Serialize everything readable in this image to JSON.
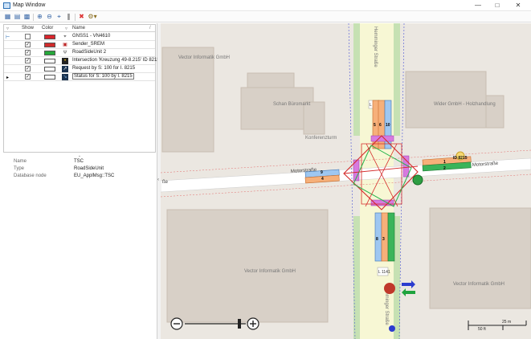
{
  "window": {
    "title": "Map Window"
  },
  "toolbar": {
    "icons": [
      "layers-icon",
      "open-icon",
      "save-icon",
      "zoom-in-icon",
      "zoom-out-icon",
      "zoom-fit-icon",
      "pause-icon",
      "close-icon",
      "settings-icon"
    ]
  },
  "layers": {
    "headers": {
      "show": "Show",
      "color": "Color",
      "name": "Name"
    },
    "rows": [
      {
        "name": "GNSS1 - VN4610",
        "checked": false,
        "color": "#d9262d",
        "icon": "gnss-icon",
        "selected": false
      },
      {
        "name": "Sender_SREM",
        "checked": true,
        "color": "#d02b2b",
        "icon": "car-icon",
        "selected": false
      },
      {
        "name": "RoadSideUnit 2",
        "checked": true,
        "color": "#25a83a",
        "icon": "antenna-icon",
        "selected": false
      },
      {
        "name": "Intersection 'Kreuzung 49-8.215' ID 8215",
        "checked": true,
        "color": "#ffffff",
        "icon": "traffic-light-icon",
        "selected": false
      },
      {
        "name": "Request by S: 100 for I. 8215",
        "checked": true,
        "color": "#ffffff",
        "icon": "request-icon",
        "selected": false
      },
      {
        "name": "Status for S: 100 by I. 8215",
        "checked": true,
        "color": "#ffffff",
        "icon": "status-icon",
        "selected": true
      }
    ]
  },
  "properties": [
    {
      "key": "Name",
      "value": "TSC"
    },
    {
      "key": "Type",
      "value": "RoadSideUnit"
    },
    {
      "key": "Database node",
      "value": "EU_ApplMsg::TSC"
    }
  ],
  "map": {
    "street_north": "Hemminger Straße",
    "street_south": "Hemminger Straße",
    "street_west": "Motorstraße",
    "street_east": "Motorstraße",
    "street_edge_west": "ße",
    "lane_north": "L 1141",
    "lane_south": "L 1141",
    "places": [
      "Vector Informatik GmbH",
      "Schan Büromarkt",
      "Konferenzturm",
      "Wider GmbH - Holzhandlung",
      "Vector Informatik GmbH",
      "Vector Informatik GmbH"
    ],
    "intersection_id": "ID 8215",
    "lane_numbers": [
      "5",
      "6",
      "10",
      "9",
      "4",
      "1",
      "2",
      "8",
      "3"
    ],
    "scale_m": "25 m",
    "scale_ft": "50 ft"
  }
}
